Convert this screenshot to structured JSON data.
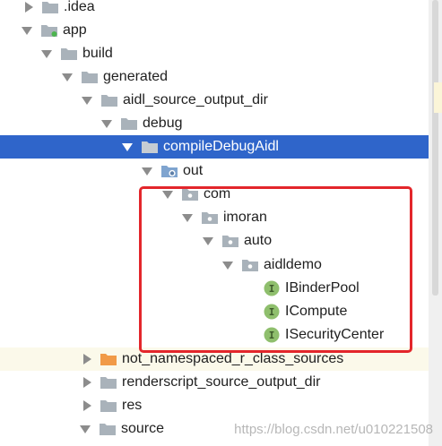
{
  "colors": {
    "selection": "#2f65ca",
    "folder": "#a9b2ba",
    "excluded_folder": "#f19a47",
    "interface_badge": "#8fbf6d",
    "highlight_box": "#e3262b"
  },
  "tree": {
    "idea": "idea-label",
    "items": [
      {
        "label": ".idea",
        "icon": "folder-icon",
        "state": "collapsed"
      },
      {
        "label": "app",
        "icon": "module-folder-icon",
        "state": "expanded"
      },
      {
        "label": "build",
        "icon": "folder-icon",
        "state": "expanded"
      },
      {
        "label": "generated",
        "icon": "folder-icon",
        "state": "expanded"
      },
      {
        "label": "aidl_source_output_dir",
        "icon": "folder-icon",
        "state": "expanded"
      },
      {
        "label": "debug",
        "icon": "folder-icon",
        "state": "expanded"
      },
      {
        "label": "compileDebugAidl",
        "icon": "folder-icon",
        "state": "expanded",
        "selected": true
      },
      {
        "label": "out",
        "icon": "source-root-folder-icon",
        "state": "expanded"
      },
      {
        "label": "com",
        "icon": "package-icon",
        "state": "expanded"
      },
      {
        "label": "imoran",
        "icon": "package-icon",
        "state": "expanded"
      },
      {
        "label": "auto",
        "icon": "package-icon",
        "state": "expanded"
      },
      {
        "label": "aidldemo",
        "icon": "package-icon",
        "state": "expanded"
      },
      {
        "label": "IBinderPool",
        "icon": "interface-icon",
        "state": "leaf"
      },
      {
        "label": "ICompute",
        "icon": "interface-icon",
        "state": "leaf"
      },
      {
        "label": "ISecurityCenter",
        "icon": "interface-icon",
        "state": "leaf"
      },
      {
        "label": "not_namespaced_r_class_sources",
        "icon": "excluded-folder-icon",
        "state": "collapsed"
      },
      {
        "label": "renderscript_source_output_dir",
        "icon": "folder-icon",
        "state": "collapsed"
      },
      {
        "label": "res",
        "icon": "folder-icon",
        "state": "collapsed"
      },
      {
        "label": "source",
        "icon": "folder-icon",
        "state": "expanded"
      }
    ],
    "badge_letter": "I"
  },
  "watermark": "https://blog.csdn.net/u010221508"
}
